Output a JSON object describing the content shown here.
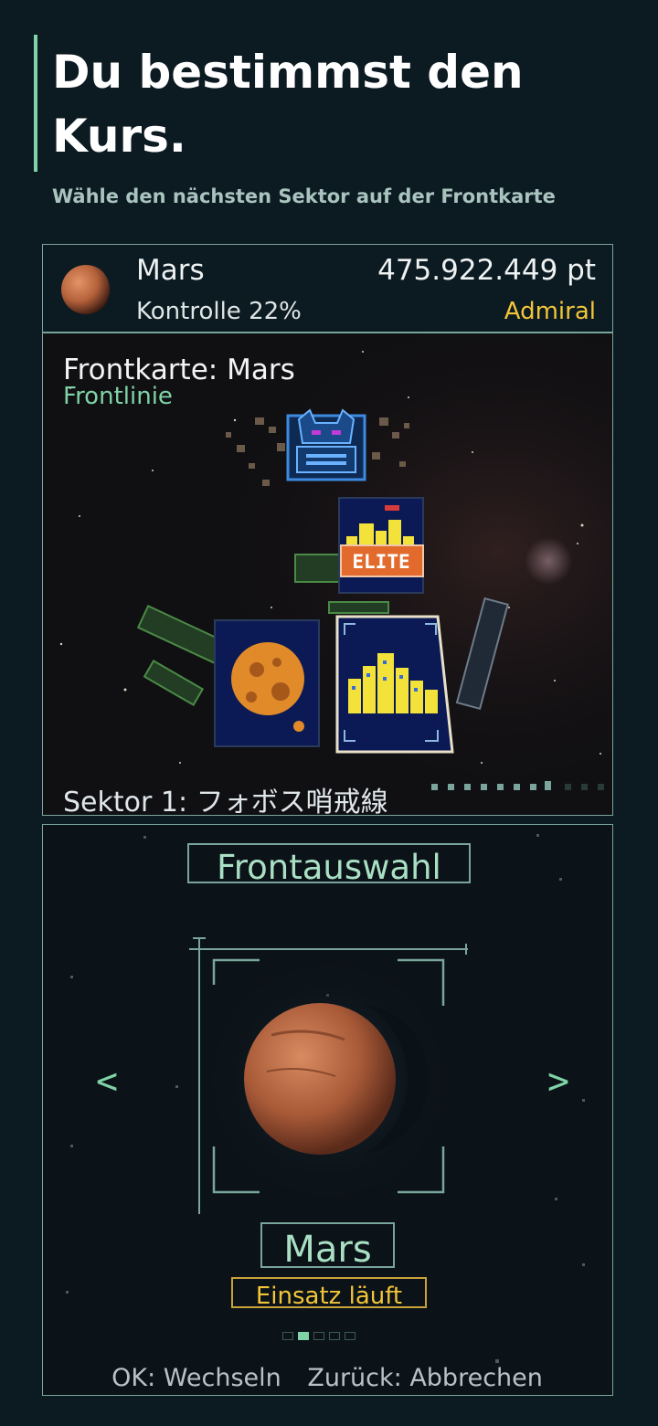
{
  "header": {
    "title": "Du bestimmst den Kurs.",
    "subtitle": "Wähle den nächsten Sektor auf der Frontkarte"
  },
  "info": {
    "planet_name": "Mars",
    "control": "Kontrolle 22%",
    "score": "475.922.449 pt",
    "rank": "Admiral",
    "rank_color": "#f2c538"
  },
  "map": {
    "title": "Frontkarte: Mars",
    "subtitle": "Frontlinie",
    "sector": "Sektor 1: フォボス哨戒線",
    "elite_label": "ELITE",
    "nodes": [
      "boss-node",
      "elite-city-node",
      "asteroid-node",
      "city-node-selected"
    ]
  },
  "selector": {
    "title": "Frontauswahl",
    "prev_icon": "<",
    "next_icon": ">",
    "planet_name": "Mars",
    "status": "Einsatz läuft",
    "page_count": 5,
    "page_active": 1,
    "controls": {
      "ok": "OK: Wechseln",
      "back": "Zurück: Abbrechen"
    }
  },
  "colors": {
    "accent": "#7fd3a6",
    "gold": "#f2c538",
    "panel_border": "#7aa59a",
    "background": "#0c1a22"
  }
}
